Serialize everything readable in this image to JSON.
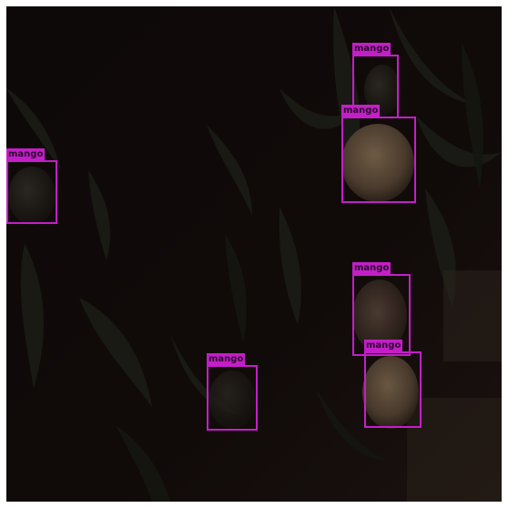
{
  "detections": [
    {
      "label": "mango"
    },
    {
      "label": "mango"
    },
    {
      "label": "mango"
    },
    {
      "label": "mango"
    },
    {
      "label": "mango"
    },
    {
      "label": "mango"
    }
  ],
  "colors": {
    "box": "#c41ec8",
    "background": "#0d0707"
  }
}
